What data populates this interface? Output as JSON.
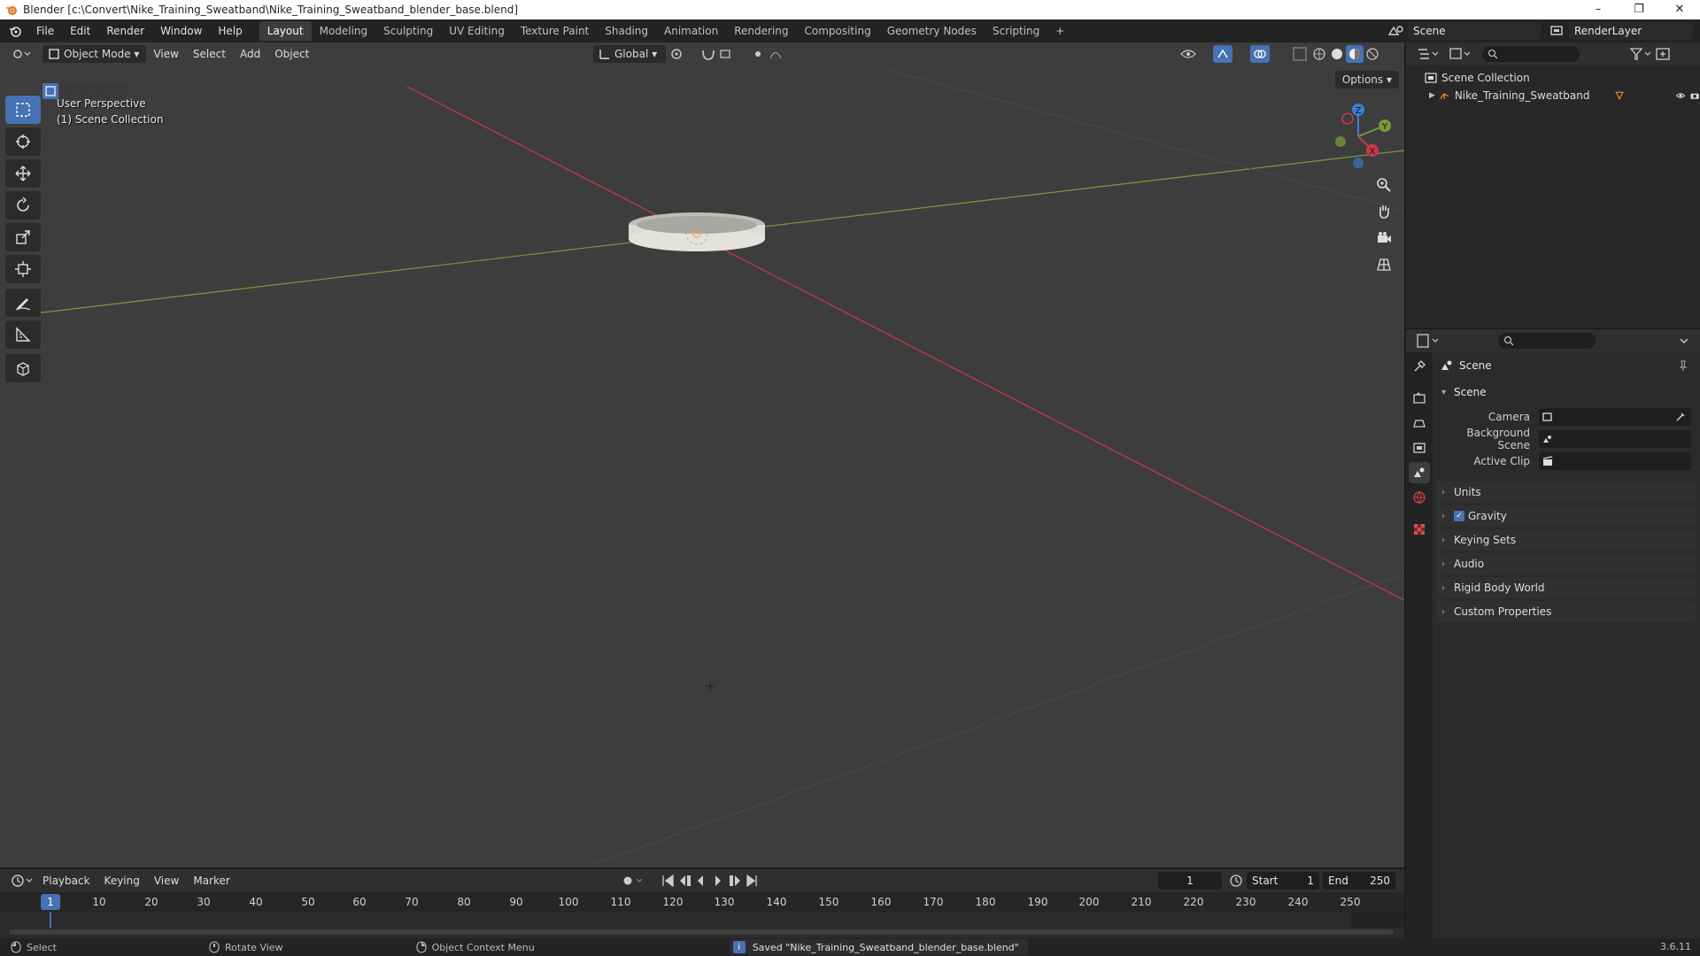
{
  "window": {
    "title": "Blender [c:\\Convert\\Nike_Training_Sweatband\\Nike_Training_Sweatband_blender_base.blend]",
    "controls": [
      "–",
      "❐",
      "✕"
    ]
  },
  "menu": [
    "File",
    "Edit",
    "Render",
    "Window",
    "Help"
  ],
  "workspaces": [
    "Layout",
    "Modeling",
    "Sculpting",
    "UV Editing",
    "Texture Paint",
    "Shading",
    "Animation",
    "Rendering",
    "Compositing",
    "Geometry Nodes",
    "Scripting",
    "+"
  ],
  "active_workspace": "Layout",
  "scene_selector": "Scene",
  "view_layer": "RenderLayer",
  "viewport": {
    "mode": "Object Mode",
    "menus": [
      "View",
      "Select",
      "Add",
      "Object"
    ],
    "orientation": "Global",
    "options_label": "Options",
    "info_line1": "User Perspective",
    "info_line2": "(1) Scene Collection",
    "gizmo": {
      "x": "X",
      "y": "Y",
      "z": "Z"
    },
    "colors": {
      "x_axis": "#c93a48",
      "y_axis": "#7a9a3a",
      "z_axis": "#3c7fd6",
      "active_tool": "#4772b3",
      "background": "#3d3d3d"
    }
  },
  "outliner": {
    "root": "Scene Collection",
    "items": [
      {
        "label": "Nike_Training_Sweatband"
      }
    ]
  },
  "properties": {
    "context": "Scene",
    "panel": "Scene",
    "fields": [
      {
        "label": "Camera",
        "value": ""
      },
      {
        "label": "Background Scene",
        "value": ""
      },
      {
        "label": "Active Clip",
        "value": ""
      }
    ],
    "subpanels": [
      {
        "label": "Units",
        "checkbox": false
      },
      {
        "label": "Gravity",
        "checkbox": true
      },
      {
        "label": "Keying Sets",
        "checkbox": false
      },
      {
        "label": "Audio",
        "checkbox": false
      },
      {
        "label": "Rigid Body World",
        "checkbox": false
      },
      {
        "label": "Custom Properties",
        "checkbox": false
      }
    ]
  },
  "timeline": {
    "menus": [
      "Playback",
      "Keying",
      "View",
      "Marker"
    ],
    "current_frame": "1",
    "start_label": "Start",
    "start": "1",
    "end_label": "End",
    "end": "250",
    "ruler": [
      "1",
      "10",
      "20",
      "30",
      "40",
      "50",
      "60",
      "70",
      "80",
      "90",
      "100",
      "110",
      "120",
      "130",
      "140",
      "150",
      "160",
      "170",
      "180",
      "190",
      "200",
      "210",
      "220",
      "230",
      "240",
      "250"
    ]
  },
  "status": {
    "select": "Select",
    "rotate": "Rotate View",
    "context_menu": "Object Context Menu",
    "message": "Saved \"Nike_Training_Sweatband_blender_base.blend\"",
    "version": "3.6.11"
  }
}
